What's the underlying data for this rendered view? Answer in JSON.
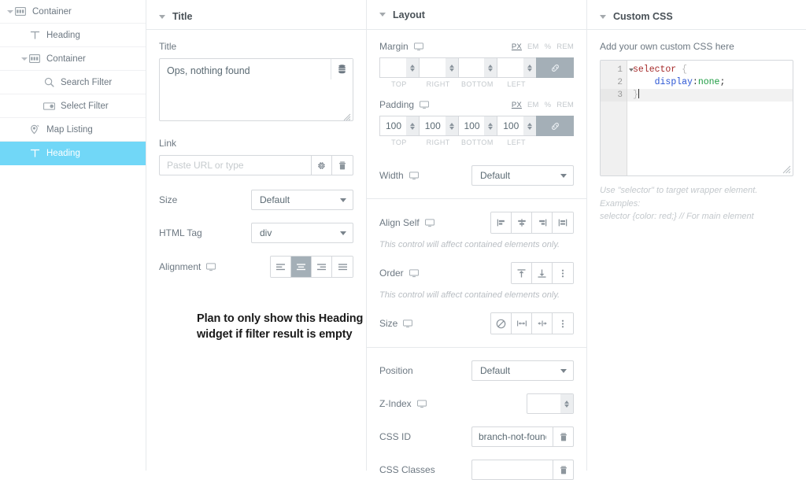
{
  "navigator": {
    "items": [
      {
        "label": "Container",
        "icon": "container-icon",
        "indent": 0,
        "arrow": true,
        "selected": false
      },
      {
        "label": "Heading",
        "icon": "heading-icon",
        "indent": 1,
        "arrow": false,
        "selected": false
      },
      {
        "label": "Container",
        "icon": "container-icon",
        "indent": 1,
        "arrow": true,
        "selected": false
      },
      {
        "label": "Search Filter",
        "icon": "search-icon",
        "indent": 2,
        "arrow": false,
        "selected": false
      },
      {
        "label": "Select Filter",
        "icon": "toggle-icon",
        "indent": 2,
        "arrow": false,
        "selected": false
      },
      {
        "label": "Map Listing",
        "icon": "map-pin-icon",
        "indent": 1,
        "arrow": false,
        "selected": false
      },
      {
        "label": "Heading",
        "icon": "heading-icon",
        "indent": 1,
        "arrow": false,
        "selected": true
      }
    ],
    "selected_color": "#71d7f7"
  },
  "annotation": {
    "line1": "Plan to only show this Heading",
    "line2": "widget if filter result is empty"
  },
  "title_panel": {
    "header": "Title",
    "title_field_label": "Title",
    "title_value": "Ops, nothing found",
    "link_label": "Link",
    "link_placeholder": "Paste URL or type",
    "link_value": "",
    "size_label": "Size",
    "size_value": "Default",
    "size_options": [
      "Default"
    ],
    "html_tag_label": "HTML Tag",
    "html_tag_value": "div",
    "html_tag_options": [
      "div"
    ],
    "alignment_label": "Alignment",
    "alignment_options": [
      "align-left",
      "align-center",
      "align-right",
      "align-justify"
    ],
    "alignment_active_index": 1
  },
  "layout_panel": {
    "header": "Layout",
    "margin": {
      "label": "Margin",
      "units": [
        "PX",
        "EM",
        "%",
        "REM"
      ],
      "active_unit": "PX",
      "values": {
        "top": "",
        "right": "",
        "bottom": "",
        "left": ""
      },
      "side_labels": [
        "TOP",
        "RIGHT",
        "BOTTOM",
        "LEFT"
      ],
      "linked": true
    },
    "padding": {
      "label": "Padding",
      "units": [
        "PX",
        "EM",
        "%",
        "REM"
      ],
      "active_unit": "PX",
      "values": {
        "top": "100",
        "right": "100",
        "bottom": "100",
        "left": "100"
      },
      "side_labels": [
        "TOP",
        "RIGHT",
        "BOTTOM",
        "LEFT"
      ],
      "linked": true
    },
    "width_label": "Width",
    "width_value": "Default",
    "width_options": [
      "Default"
    ],
    "align_self_label": "Align Self",
    "align_self_hint": "This control will affect contained elements only.",
    "order_label": "Order",
    "order_hint": "This control will affect contained elements only.",
    "size_label": "Size",
    "position_label": "Position",
    "position_value": "Default",
    "position_options": [
      "Default"
    ],
    "z_index_label": "Z-Index",
    "z_index_value": "",
    "css_id_label": "CSS ID",
    "css_id_value": "branch-not-found",
    "css_classes_label": "CSS Classes",
    "css_classes_value": ""
  },
  "custom_css_panel": {
    "header": "Custom CSS",
    "description": "Add your own custom CSS here",
    "line_numbers": [
      "1",
      "2",
      "3"
    ],
    "code": {
      "l1_selector": "selector",
      "l1_brace": "{",
      "l2_prop": "display",
      "l2_colon": ":",
      "l2_value": "none",
      "l2_semi": ";",
      "l3_brace": "}"
    },
    "footer_line1": "Use \"selector\" to target wrapper element. Examples:",
    "footer_line2": "selector {color: red;} // For main element"
  }
}
